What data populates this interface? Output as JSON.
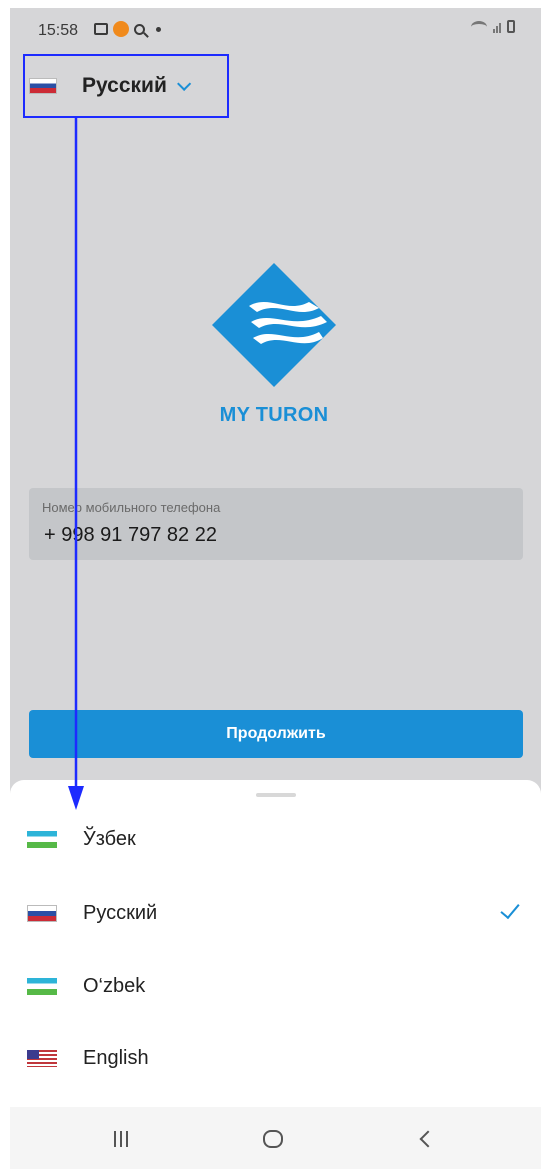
{
  "status_bar": {
    "time": "15:58",
    "icons": [
      "gallery-icon",
      "app-notification-icon",
      "search-icon",
      "dot-icon",
      "wifi-icon",
      "signal-icon",
      "battery-icon"
    ]
  },
  "language_selector": {
    "selected": "Русский",
    "flag": "russia-flag",
    "highlight_color": "#1d2bff"
  },
  "logo": {
    "text": "MY TURON",
    "color": "#1a8fd6"
  },
  "phone_field": {
    "label": "Номер мобильного телефона",
    "value": "+ 998 91 797 82 22"
  },
  "continue_button": {
    "label": "Продолжить",
    "color": "#1a8fd6"
  },
  "language_sheet": {
    "items": [
      {
        "label": "Ўзбек",
        "flag": "uzbekistan-flag",
        "selected": false
      },
      {
        "label": "Русский",
        "flag": "russia-flag",
        "selected": true
      },
      {
        "label": "O‘zbek",
        "flag": "uzbekistan-flag",
        "selected": false
      },
      {
        "label": "English",
        "flag": "usa-flag",
        "selected": false
      }
    ]
  },
  "nav_bar": {
    "buttons": [
      "recent-apps-icon",
      "home-icon",
      "back-icon"
    ]
  }
}
